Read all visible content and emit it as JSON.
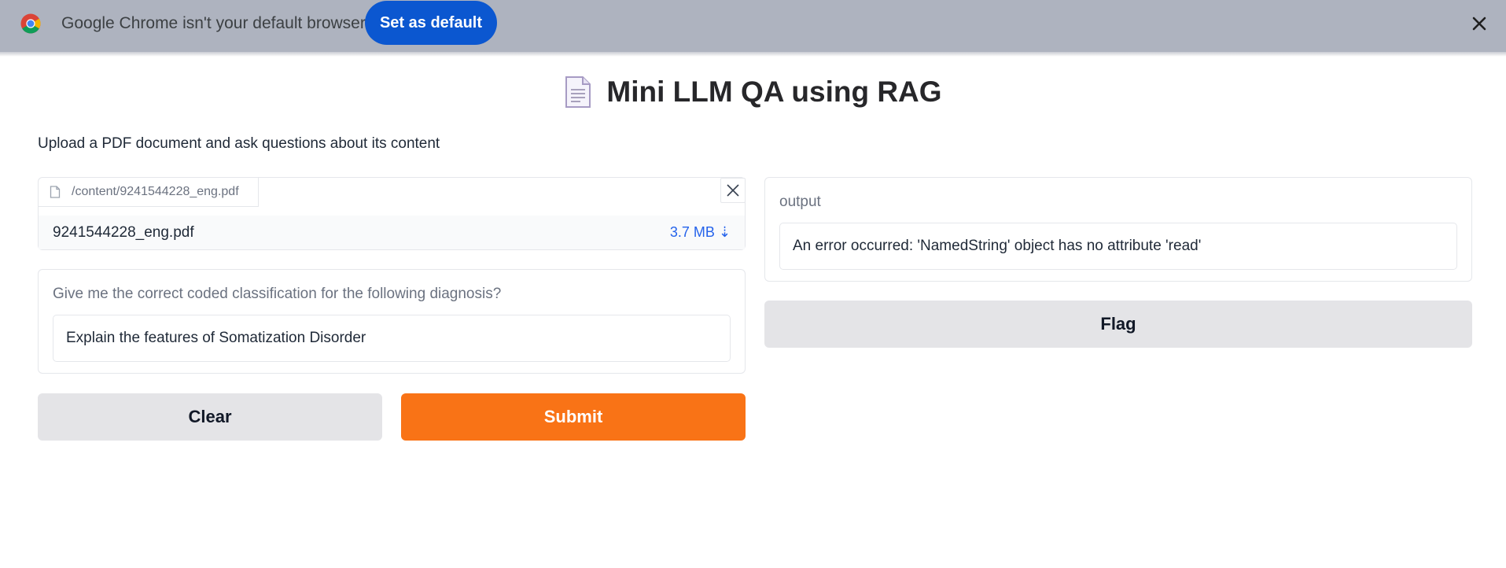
{
  "infobar": {
    "message": "Google Chrome isn't your default browser",
    "set_default_label": "Set as default",
    "icons": {
      "logo": "chrome-logo-icon",
      "close": "close-icon"
    }
  },
  "header": {
    "title": "Mini LLM QA using RAG",
    "title_icon": "document-icon",
    "description": "Upload a PDF document and ask questions about its content"
  },
  "file_upload": {
    "path": "/content/9241544228_eng.pdf",
    "file_name": "9241544228_eng.pdf",
    "file_size": "3.7 MB ⇣"
  },
  "question": {
    "label": "Give me the correct coded classification for the following diagnosis?",
    "value": "Explain the features of Somatization Disorder"
  },
  "buttons": {
    "clear": "Clear",
    "submit": "Submit",
    "flag": "Flag"
  },
  "output": {
    "label": "output",
    "text": "An error occurred: 'NamedString' object has no attribute 'read'"
  },
  "colors": {
    "infobar_bg": "#aeb3bf",
    "primary_blue": "#0b57d0",
    "submit_orange": "#f97316",
    "secondary_gray": "#e4e4e7"
  }
}
